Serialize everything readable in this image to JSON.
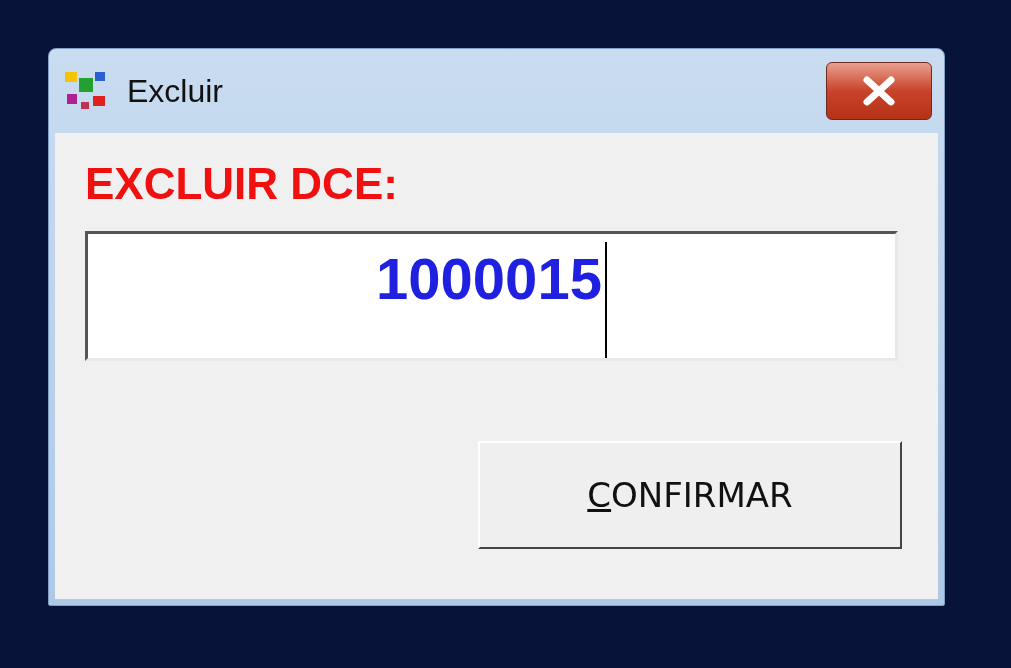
{
  "window": {
    "title": "Excluir"
  },
  "prompt": "EXCLUIR DCE:",
  "field": {
    "value": "1000015",
    "focused": true
  },
  "button": {
    "access_key": "C",
    "rest": "ONFIRMAR"
  }
}
